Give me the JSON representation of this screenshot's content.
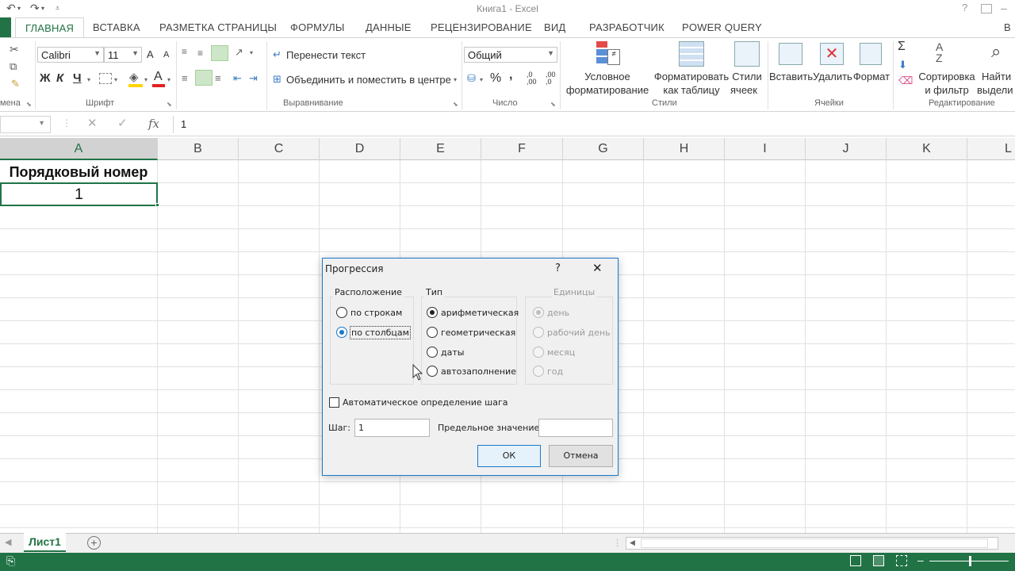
{
  "window": {
    "title": "Книга1 - Excel",
    "help": "?"
  },
  "tabs": [
    "ГЛАВНАЯ",
    "ВСТАВКА",
    "РАЗМЕТКА СТРАНИЦЫ",
    "ФОРМУЛЫ",
    "ДАННЫЕ",
    "РЕЦЕНЗИРОВАНИЕ",
    "ВИД",
    "РАЗРАБОТЧИК",
    "POWER QUERY",
    "В"
  ],
  "ribbon": {
    "clipboard_label": "мена",
    "font_name": "Calibri",
    "font_size": "11",
    "font_increase": "A",
    "font_decrease": "A",
    "bold": "Ж",
    "italic": "К",
    "underline": "Ч",
    "font_label": "Шрифт",
    "wrap_text": "Перенести текст",
    "merge_center": "Объединить и поместить в центре",
    "align_label": "Выравнивание",
    "number_format": "Общий",
    "percent": "%",
    "comma": ",",
    "inc_decimal": ",0 ,00",
    "dec_decimal": ",00 ,0",
    "number_label": "Число",
    "cond_format_1": "Условное",
    "cond_format_2": "форматирование",
    "format_table_1": "Форматировать",
    "format_table_2": "как таблицу",
    "cell_styles_1": "Стили",
    "cell_styles_2": "ячеек",
    "styles_label": "Стили",
    "insert": "Вставить",
    "delete": "Удалить",
    "format": "Формат",
    "cells_label": "Ячейки",
    "sort_1": "Сортировка",
    "sort_2": "и фильтр",
    "find_1": "Найти",
    "find_2": "выдели",
    "editing_label": "Редактирование",
    "sigma": "Σ"
  },
  "formula_bar": {
    "fx": "fx",
    "value": "1"
  },
  "columns": [
    "A",
    "B",
    "C",
    "D",
    "E",
    "F",
    "G",
    "H",
    "I",
    "J",
    "K",
    "L"
  ],
  "cells": {
    "a1": "Порядковый номер",
    "a2": "1"
  },
  "sheet": {
    "name": "Лист1"
  },
  "dialog": {
    "title": "Прогрессия",
    "help": "?",
    "close": "✕",
    "location_title": "Расположение",
    "location_options": [
      "по строкам",
      "по столбцам"
    ],
    "type_title": "Тип",
    "type_options": [
      "арифметическая",
      "геометрическая",
      "даты",
      "автозаполнение"
    ],
    "units_title": "Единицы",
    "units_options": [
      "день",
      "рабочий день",
      "месяц",
      "год"
    ],
    "auto_step": "Автоматическое определение шага",
    "step_label": "Шаг:",
    "step_value": "1",
    "stop_label": "Предельное значение:",
    "stop_value": "",
    "ok": "ОК",
    "cancel": "Отмена"
  },
  "colors": {
    "accent": "#217346",
    "dialog_border": "#1979ca"
  }
}
